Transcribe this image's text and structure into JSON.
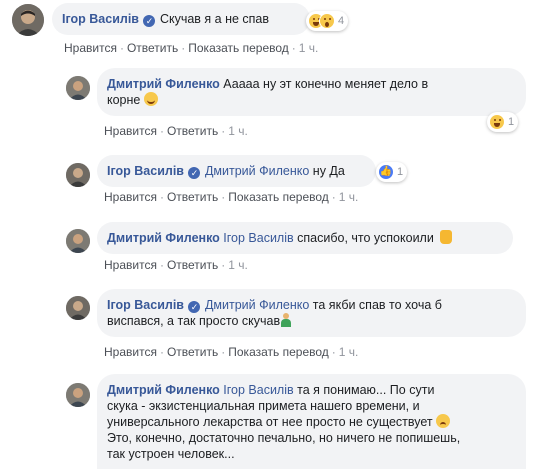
{
  "colors": {
    "author": "#385898",
    "bubble": "#f2f3f5",
    "meta": "#90949c",
    "link": "#4b4f56"
  },
  "actions": {
    "like": "Нравится",
    "reply": "Ответить",
    "translate": "Показать перевод",
    "dot": "·"
  },
  "comments": [
    {
      "author": "Ігор Василів",
      "verified": true,
      "text": "Скучав я а не спав",
      "time": "1 ч.",
      "reactions": {
        "icons": [
          "haha-icon",
          "wow-icon"
        ],
        "count": "4"
      },
      "show_translate": true
    },
    {
      "author": "Дмитрий Филенко",
      "text_line1": "Ааааа ну эт конечно меняет дело в",
      "text_line2": "корне",
      "time": "1 ч.",
      "reactions": {
        "icons": [
          "haha-icon"
        ],
        "count": "1"
      }
    },
    {
      "author": "Ігор Василів",
      "verified": true,
      "mention": "Дмитрий Филенко",
      "text": "ну Да",
      "time": "1 ч.",
      "reactions": {
        "icons": [
          "like-icon"
        ],
        "count": "1"
      },
      "show_translate": true
    },
    {
      "author": "Дмитрий Филенко",
      "mention": "Ігор Василів",
      "text": "спасибо, что успокоили",
      "time": "1 ч."
    },
    {
      "author": "Ігор Василів",
      "verified": true,
      "mention": "Дмитрий Филенко",
      "text_line1": "та якби спав то хоча б",
      "text_line2": "виспався, а так просто скучав",
      "time": "1 ч.",
      "show_translate": true
    },
    {
      "author": "Дмитрий Филенко",
      "mention": "Ігор Василів",
      "text_line1": "та я понимаю... По сути",
      "text_line2": "скука - экзистенциальная примета нашего времени, и",
      "text_line3": "универсального лекарства от нее просто не существует",
      "text_line4": "Это, конечно, достаточно печально, но ничего не попишешь,",
      "text_line5": "так устроен человек..."
    }
  ]
}
